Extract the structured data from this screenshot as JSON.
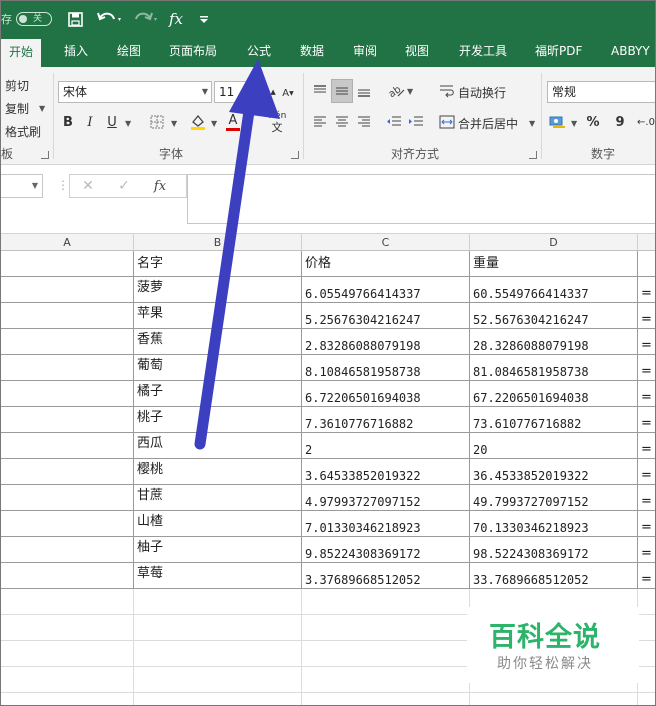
{
  "titlebar": {
    "toggle_label": "存",
    "toggle_state": "关",
    "icons": [
      "save-icon",
      "undo-icon",
      "redo-icon",
      "fx-icon",
      "customize-icon"
    ],
    "fx_label": "fx"
  },
  "tabs": [
    "开始",
    "插入",
    "绘图",
    "页面布局",
    "公式",
    "数据",
    "审阅",
    "视图",
    "开发工具",
    "福昕PDF",
    "ABBYY"
  ],
  "ribbon": {
    "clipboard": {
      "cut": "剪切",
      "copy": "复制",
      "format_painter": "格式刷",
      "group": "板"
    },
    "font": {
      "name": "宋体",
      "size": "11",
      "bold": "B",
      "italic": "I",
      "underline": "U",
      "font_color": "A",
      "phonetic_top": "wén",
      "phonetic_bottom": "文",
      "group": "字体"
    },
    "alignment": {
      "wrap": "自动换行",
      "merge": "合并后居中",
      "group": "对齐方式"
    },
    "number": {
      "format": "常规",
      "percent": "%",
      "comma": "9",
      "group": "数字"
    }
  },
  "formula_bar": {
    "fx": "fx",
    "cancel": "✕",
    "enter": "✓",
    "value": ""
  },
  "columns": [
    "A",
    "B",
    "C",
    "D"
  ],
  "table": {
    "headers": [
      "名字",
      "价格",
      "重量"
    ],
    "rows": [
      [
        "菠萝",
        "6.05549766414337",
        "60.5549766414337"
      ],
      [
        "苹果",
        "5.25676304216247",
        "52.5676304216247"
      ],
      [
        "香蕉",
        "2.83286088079198",
        "28.3286088079198"
      ],
      [
        "葡萄",
        "8.10846581958738",
        "81.0846581958738"
      ],
      [
        "橘子",
        "6.72206501694038",
        "67.2206501694038"
      ],
      [
        "桃子",
        "7.3610776716882",
        "73.610776716882"
      ],
      [
        "西瓜",
        "2",
        "20"
      ],
      [
        "樱桃",
        "3.64533852019322",
        "36.4533852019322"
      ],
      [
        "甘蔗",
        "4.97993727097152",
        "49.7993727097152"
      ],
      [
        "山楂",
        "7.01330346218923",
        "70.1330346218923"
      ],
      [
        "柚子",
        "9.85224308369172",
        "98.5224308369172"
      ],
      [
        "草莓",
        "3.37689668512052",
        "33.7689668512052"
      ]
    ],
    "col_e_partial": "="
  },
  "watermark": {
    "title": "百科全说",
    "subtitle": "助你轻松解决"
  },
  "colors": {
    "excel_green": "#217346",
    "arrow": "#3c3fc0",
    "watermark_green": "#2db36a"
  }
}
